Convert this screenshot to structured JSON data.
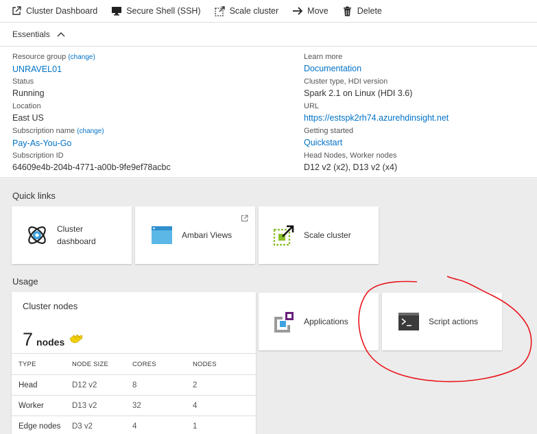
{
  "toolbar": {
    "cluster_dashboard": "Cluster Dashboard",
    "secure_shell": "Secure Shell (SSH)",
    "scale_cluster": "Scale cluster",
    "move": "Move",
    "delete": "Delete"
  },
  "essentials": {
    "title": "Essentials",
    "left": [
      {
        "label": "Resource group",
        "change": "(change)",
        "value": "UNRAVEL01",
        "link": true
      },
      {
        "label": "Status",
        "value": "Running",
        "link": false
      },
      {
        "label": "Location",
        "value": "East US",
        "link": false
      },
      {
        "label": "Subscription name",
        "change": "(change)",
        "value": "Pay-As-You-Go",
        "link": true
      },
      {
        "label": "Subscription ID",
        "value": "64609e4b-204b-4771-a00b-9fe9ef78acbc",
        "link": false
      }
    ],
    "right": [
      {
        "label": "Learn more",
        "value": "Documentation",
        "link": true
      },
      {
        "label": "Cluster type, HDI version",
        "value": "Spark 2.1 on Linux (HDI 3.6)",
        "link": false
      },
      {
        "label": "URL",
        "value": "https://estspk2rh74.azurehdinsight.net",
        "link": true
      },
      {
        "label": "Getting started",
        "value": "Quickstart",
        "link": true
      },
      {
        "label": "Head Nodes, Worker nodes",
        "value": "D12 v2 (x2), D13 v2 (x4)",
        "link": false
      }
    ]
  },
  "quick_links": {
    "title": "Quick links",
    "tiles": [
      {
        "label_line1": "Cluster",
        "label_line2": "dashboard"
      },
      {
        "label": "Ambari Views"
      },
      {
        "label": "Scale cluster"
      }
    ]
  },
  "usage": {
    "title": "Usage",
    "cluster_nodes": {
      "title": "Cluster nodes",
      "count": "7",
      "unit": "nodes",
      "columns": [
        "TYPE",
        "NODE SIZE",
        "CORES",
        "NODES"
      ],
      "rows": [
        [
          "Head",
          "D12 v2",
          "8",
          "2"
        ],
        [
          "Worker",
          "D13 v2",
          "32",
          "4"
        ],
        [
          "Edge nodes",
          "D3 v2",
          "4",
          "1"
        ]
      ]
    },
    "tiles": [
      {
        "label": "Applications"
      },
      {
        "label": "Script actions"
      }
    ]
  },
  "colors": {
    "link": "#0072c6",
    "annotation": "#e8141b",
    "dashboard_bg": "#ececec"
  },
  "icons": [
    "external-link-icon",
    "monitor-icon",
    "scale-icon",
    "arrow-right-icon",
    "trash-icon",
    "chevron-up-icon",
    "cluster-dashboard-icon",
    "ambari-views-icon",
    "applications-icon",
    "terminal-icon",
    "pointing-hand-icon"
  ]
}
